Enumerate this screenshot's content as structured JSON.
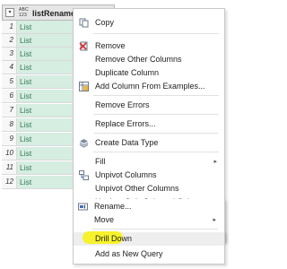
{
  "column": {
    "type_line1": "ABC",
    "type_line2": "123",
    "name": "listRenames",
    "menu_glyph": "▾",
    "expand_glyph": "⇔"
  },
  "rows": [
    {
      "n": "1",
      "v": "List"
    },
    {
      "n": "2",
      "v": "List"
    },
    {
      "n": "3",
      "v": "List"
    },
    {
      "n": "4",
      "v": "List"
    },
    {
      "n": "5",
      "v": "List"
    },
    {
      "n": "6",
      "v": "List"
    },
    {
      "n": "7",
      "v": "List"
    },
    {
      "n": "8",
      "v": "List"
    },
    {
      "n": "9",
      "v": "List"
    },
    {
      "n": "10",
      "v": "List"
    },
    {
      "n": "11",
      "v": "List"
    },
    {
      "n": "12",
      "v": "List"
    }
  ],
  "context_menu": {
    "copy": "Copy",
    "remove": "Remove",
    "remove_other": "Remove Other Columns",
    "duplicate": "Duplicate Column",
    "add_from_examples": "Add Column From Examples...",
    "remove_errors": "Remove Errors",
    "replace_errors": "Replace Errors...",
    "create_data_type": "Create Data Type",
    "fill": "Fill",
    "unpivot": "Unpivot Columns",
    "unpivot_other": "Unpivot Other Columns",
    "unpivot_selected": "Unpivot Only Selected Columns",
    "rename": "Rename...",
    "move": "Move",
    "drill_down": "Drill Down",
    "add_new_query": "Add as New Query",
    "submenu_arrow": "▸"
  },
  "colors": {
    "cell_bg": "#d6ede2",
    "cell_text": "#2f7a53",
    "highlight": "#f6f22c"
  }
}
